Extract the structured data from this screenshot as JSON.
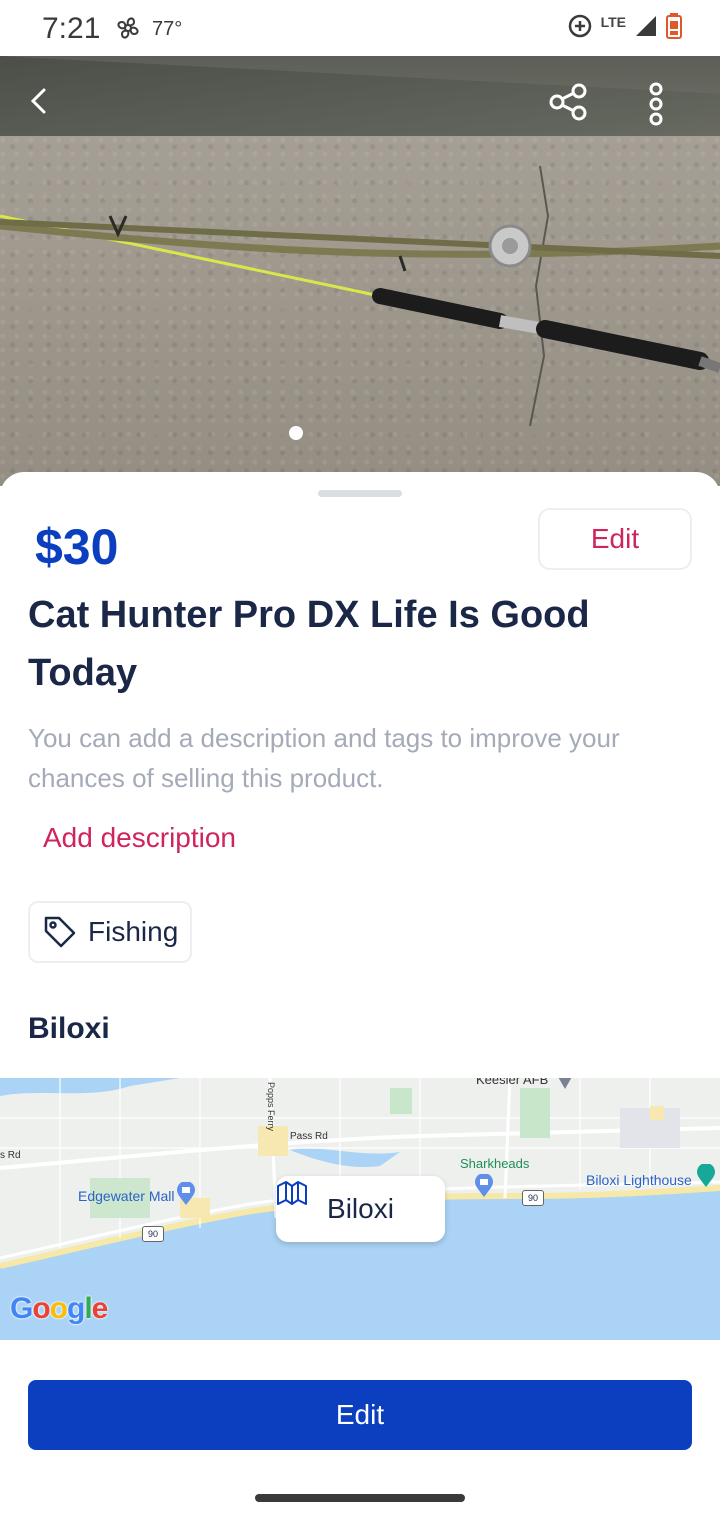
{
  "status_bar": {
    "time": "7:21",
    "temperature": "77°",
    "network": "LTE",
    "icons": [
      "fan-icon",
      "data-saver-icon",
      "signal-icon",
      "battery-icon"
    ]
  },
  "hero": {
    "icons": {
      "back": "chevron-left-icon",
      "share": "share-icon",
      "more": "more-vertical-icon"
    },
    "image_count": 1,
    "current_image": 1
  },
  "listing": {
    "price": "$30",
    "edit_label": "Edit",
    "title": "Cat Hunter Pro DX Life Is Good Today",
    "description_hint": "You can add a description and tags to improve your chances of selling this product.",
    "add_description_label": "Add description",
    "tag": "Fishing",
    "location": "Biloxi"
  },
  "map": {
    "chip_label": "Biloxi",
    "labels": {
      "keesler": "Keesler AFB",
      "pass_rd": "Pass Rd",
      "sharkheads": "Sharkheads",
      "edgewater": "Edgewater Mall",
      "lighthouse": "Biloxi Lighthouse",
      "route_90_a": "90",
      "route_90_b": "90",
      "popps": "Popps Ferry",
      "rd": "s Rd"
    },
    "attribution": "Google"
  },
  "bottom": {
    "edit_label": "Edit"
  },
  "colors": {
    "primary": "#0b3fbf",
    "accent": "#d0245c",
    "text": "#1a2747",
    "muted": "#a4abb7"
  }
}
